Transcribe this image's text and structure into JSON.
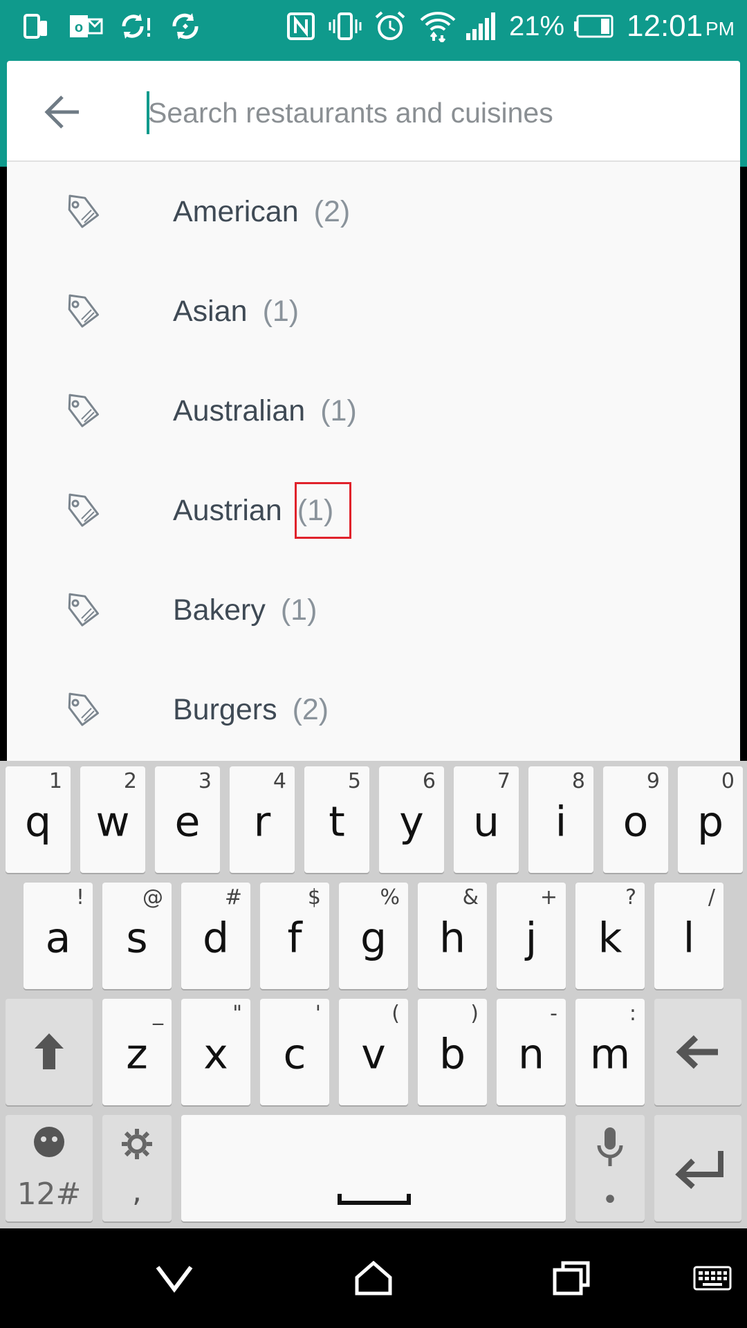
{
  "status_bar": {
    "battery": "21%",
    "time": "12:01",
    "ampm": "PM"
  },
  "search": {
    "placeholder": "Search restaurants and cuisines",
    "value": ""
  },
  "results": [
    {
      "name": "American",
      "count": "(2)"
    },
    {
      "name": "Asian",
      "count": "(1)"
    },
    {
      "name": "Australian",
      "count": "(1)"
    },
    {
      "name": "Austrian",
      "count": "(1)"
    },
    {
      "name": "Bakery",
      "count": "(1)"
    },
    {
      "name": "Burgers",
      "count": "(2)"
    }
  ],
  "keyboard": {
    "row1": [
      {
        "k": "q",
        "s": "1"
      },
      {
        "k": "w",
        "s": "2"
      },
      {
        "k": "e",
        "s": "3"
      },
      {
        "k": "r",
        "s": "4"
      },
      {
        "k": "t",
        "s": "5"
      },
      {
        "k": "y",
        "s": "6"
      },
      {
        "k": "u",
        "s": "7"
      },
      {
        "k": "i",
        "s": "8"
      },
      {
        "k": "o",
        "s": "9"
      },
      {
        "k": "p",
        "s": "0"
      }
    ],
    "row2": [
      {
        "k": "a",
        "s": "!"
      },
      {
        "k": "s",
        "s": "@"
      },
      {
        "k": "d",
        "s": "#"
      },
      {
        "k": "f",
        "s": "$"
      },
      {
        "k": "g",
        "s": "%"
      },
      {
        "k": "h",
        "s": "&"
      },
      {
        "k": "j",
        "s": "+"
      },
      {
        "k": "k",
        "s": "?"
      },
      {
        "k": "l",
        "s": "/"
      }
    ],
    "row3": [
      {
        "k": "z",
        "s": "_"
      },
      {
        "k": "x",
        "s": "\""
      },
      {
        "k": "c",
        "s": "'"
      },
      {
        "k": "v",
        "s": "("
      },
      {
        "k": "b",
        "s": ")"
      },
      {
        "k": "n",
        "s": "-"
      },
      {
        "k": "m",
        "s": ":"
      }
    ],
    "symbols_label": "12#",
    "comma_label": ","
  },
  "colors": {
    "accent": "#0f9a8c",
    "highlight": "#e0222b"
  }
}
